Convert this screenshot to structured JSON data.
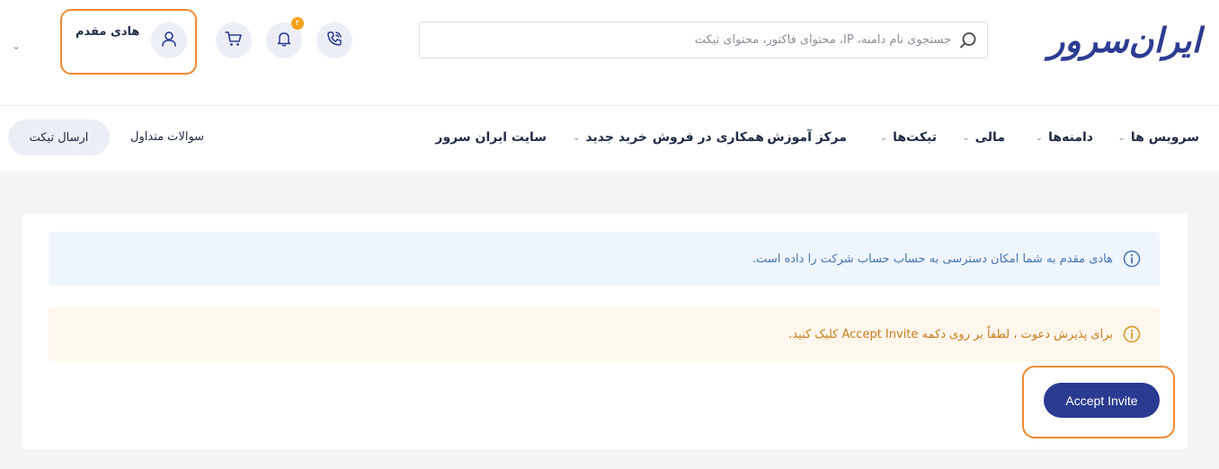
{
  "header": {
    "logo_text": "ایران‌سرور",
    "search": {
      "placeholder": "جستجوی نام دامنه، IP، محتوای فاکتور، محتوای تیکت",
      "value": ""
    },
    "notification_count": "۲",
    "user_name": "هادی مقدم",
    "icons": [
      "phone-call-icon",
      "bell-icon",
      "cart-icon",
      "user-icon",
      "chevron-down-icon"
    ]
  },
  "nav": {
    "items": [
      {
        "label": "سرویس ها",
        "has_dropdown": true
      },
      {
        "label": "دامنه‌ها",
        "has_dropdown": true
      },
      {
        "label": "مالی",
        "has_dropdown": true
      },
      {
        "label": "تیکت‌ها",
        "has_dropdown": true
      },
      {
        "label": "مرکز آموزش",
        "has_dropdown": false
      },
      {
        "label": "همکاری در فروش",
        "has_dropdown": false
      },
      {
        "label": "خرید جدید",
        "has_dropdown": true
      },
      {
        "label": "سایت ایران سرور",
        "has_dropdown": false
      }
    ],
    "faq_label": "سوالات متداول",
    "ticket_button_label": "ارسال تیکت"
  },
  "main": {
    "info_alert": "هادی مقدم به شما امکان دسترسی به حساب حساب شرکت را داده است.",
    "warning_alert": "برای پذیرش دعوت ، لطفاً بر روی دکمه Accept Invite کلیک کنید.",
    "accept_button_label": "Accept Invite"
  },
  "colors": {
    "brand": "#2b3b92",
    "highlight": "#f08a30",
    "info_bg": "#eef5fd",
    "warning_bg": "#fff6ec",
    "badge": "#f6a11a"
  }
}
